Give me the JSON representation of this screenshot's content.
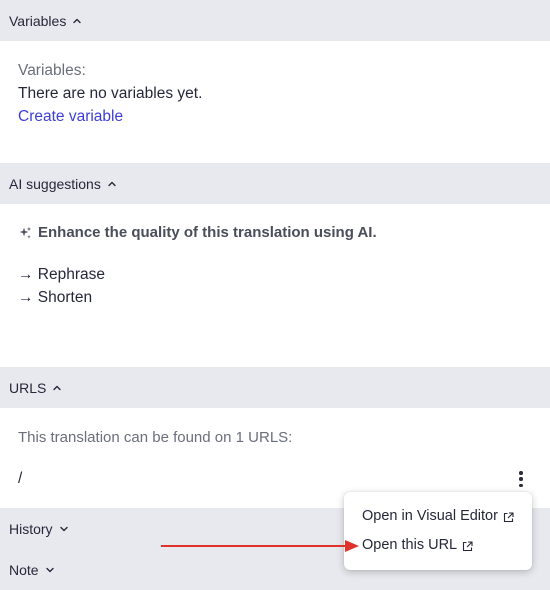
{
  "variables": {
    "header": "Variables",
    "label": "Variables:",
    "empty_text": "There are no variables yet.",
    "create_link": "Create variable"
  },
  "ai": {
    "header": "AI suggestions",
    "title": "Enhance the quality of this translation using AI.",
    "options": [
      "→ Rephrase",
      "→ Shorten"
    ]
  },
  "urls": {
    "header": "URLS",
    "description": "This translation can be found on 1 URLS:",
    "items": [
      "/"
    ]
  },
  "history": {
    "header": "History"
  },
  "note": {
    "header": "Note"
  },
  "menu": {
    "open_visual_editor": "Open in Visual Editor",
    "open_url": "Open this URL"
  },
  "colors": {
    "header_bg": "#e8e9ee",
    "link": "#3d3fd4",
    "annotation_arrow": "#e0312b"
  }
}
